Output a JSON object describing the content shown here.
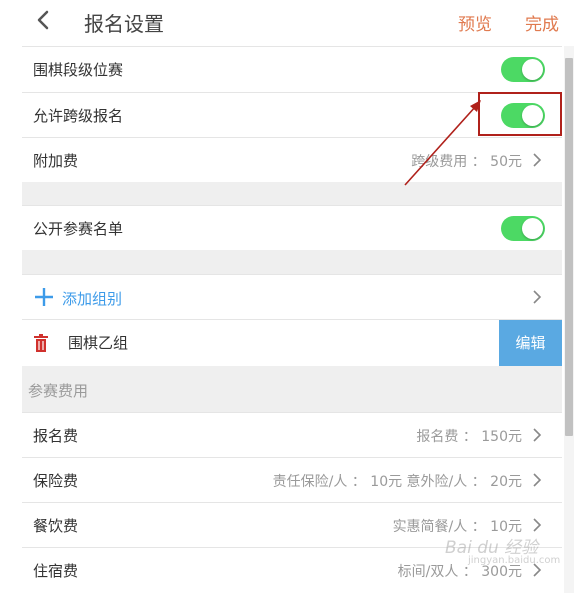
{
  "header": {
    "title": "报名设置",
    "preview": "预览",
    "done": "完成"
  },
  "rows": {
    "weiqi_rank": {
      "label": "围棋段级位赛",
      "enabled": true
    },
    "cross_level": {
      "label": "允许跨级报名",
      "enabled": true
    },
    "extra_fee": {
      "label": "附加费",
      "value": "跨级费用 ： 50元"
    },
    "public_list": {
      "label": "公开参赛名单",
      "enabled": true
    },
    "add_group": {
      "label": "添加组别"
    },
    "group_item": {
      "label": "围棋乙组",
      "edit": "编辑"
    }
  },
  "fees": {
    "section_title": "参赛费用",
    "items": [
      {
        "label": "报名费",
        "value": "报名费 ： 150元"
      },
      {
        "label": "保险费",
        "value": "责任保险/人 ： 10元 意外险/人 ： 20元"
      },
      {
        "label": "餐饮费",
        "value": "实惠简餐/人 ： 10元"
      },
      {
        "label": "住宿费",
        "value": "标间/双人 ： 300元"
      }
    ]
  },
  "watermark": {
    "brand": "Bai du 经验",
    "url": "jingyan.baidu.com"
  },
  "colors": {
    "accent": "#e07a4f",
    "toggle_on": "#4cd964",
    "link": "#3d9be9",
    "edit_bg": "#5aa9e2",
    "annotation": "#b0211b"
  },
  "icons": [
    "back-chevron-icon",
    "chevron-right-icon",
    "plus-icon",
    "trash-icon"
  ]
}
